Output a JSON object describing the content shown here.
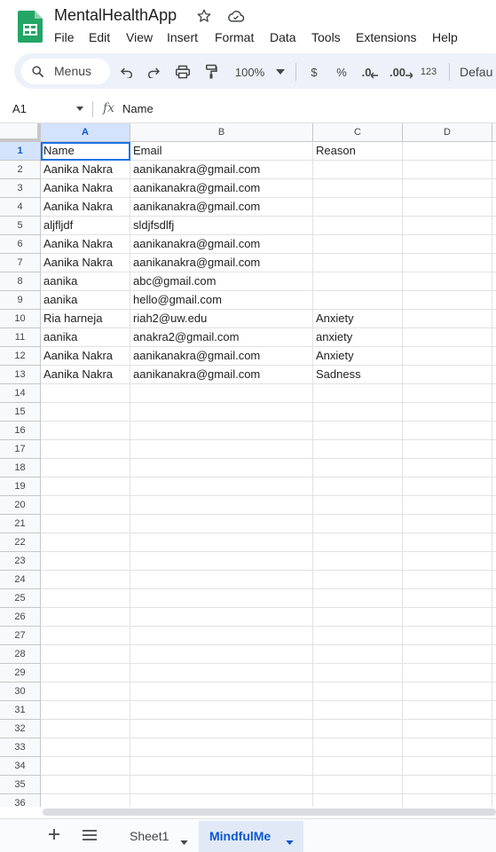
{
  "app": {
    "title": "MentalHealthApp",
    "menu": [
      "File",
      "Edit",
      "View",
      "Insert",
      "Format",
      "Data",
      "Tools",
      "Extensions",
      "Help"
    ]
  },
  "toolbar": {
    "search_label": "Menus",
    "zoom": "100%",
    "currency": "$",
    "percent": "%",
    "decrease_decimal": ".0",
    "increase_decimal": ".00",
    "number_format": "123",
    "font": "Defau"
  },
  "formula_bar": {
    "name_box": "A1",
    "fx": "fx",
    "formula": "Name"
  },
  "grid": {
    "columns": [
      "A",
      "B",
      "C",
      "D"
    ],
    "rows": [
      "1",
      "2",
      "3",
      "4",
      "5",
      "6",
      "7",
      "8",
      "9",
      "10",
      "11",
      "12",
      "13",
      "14",
      "15",
      "16",
      "17",
      "18",
      "19",
      "20",
      "21",
      "22",
      "23",
      "24",
      "25",
      "26",
      "27",
      "28",
      "29",
      "30",
      "31",
      "32",
      "33",
      "34",
      "35",
      "36"
    ],
    "data": [
      [
        "Name",
        "Email",
        "Reason"
      ],
      [
        "Aanika Nakra",
        "aanikanakra@gmail.com",
        ""
      ],
      [
        "Aanika Nakra",
        "aanikanakra@gmail.com",
        ""
      ],
      [
        "Aanika Nakra",
        "aanikanakra@gmail.com",
        ""
      ],
      [
        "aljfljdf",
        "sldjfsdlfj",
        ""
      ],
      [
        "Aanika Nakra",
        "aanikanakra@gmail.com",
        ""
      ],
      [
        "Aanika Nakra",
        "aanikanakra@gmail.com",
        ""
      ],
      [
        "aanika",
        "abc@gmail.com",
        ""
      ],
      [
        "aanika",
        "hello@gmail.com",
        ""
      ],
      [
        "Ria harneja",
        "riah2@uw.edu",
        "Anxiety"
      ],
      [
        "aanika",
        "anakra2@gmail.com",
        "anxiety"
      ],
      [
        "Aanika Nakra",
        "aanikanakra@gmail.com",
        "Anxiety"
      ],
      [
        "Aanika Nakra",
        "aanikanakra@gmail.com",
        "Sadness"
      ]
    ]
  },
  "sheets": {
    "tabs": [
      "Sheet1",
      "MindfulMe"
    ],
    "active": "MindfulMe"
  },
  "colors": {
    "accent": "#0b57d0",
    "selection": "#d3e3fd",
    "toolbar_bg": "#edf2fa"
  }
}
